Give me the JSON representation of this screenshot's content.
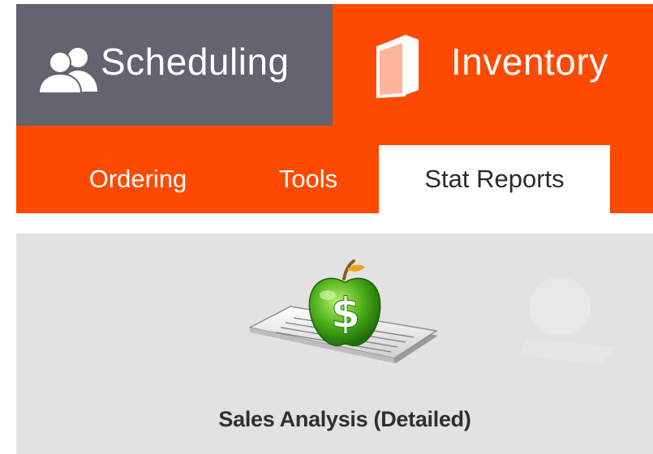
{
  "main_tabs": {
    "scheduling": {
      "label": "Scheduling",
      "icon": "users-icon"
    },
    "inventory": {
      "label": "Inventory",
      "icon": "book-icon"
    }
  },
  "sub_tabs": {
    "ordering": {
      "label": "Ordering"
    },
    "tools": {
      "label": "Tools"
    },
    "stat_reports": {
      "label": "Stat Reports",
      "selected": true
    }
  },
  "reports": {
    "sales_analysis": {
      "label": "Sales Analysis (Detailed)",
      "icon": "apple-dollar-report-icon"
    }
  },
  "colors": {
    "accent": "#fe4a00",
    "inactive_tab": "#64636f",
    "content_background": "#e2e2e2",
    "apple_green": "#4caf1a"
  }
}
